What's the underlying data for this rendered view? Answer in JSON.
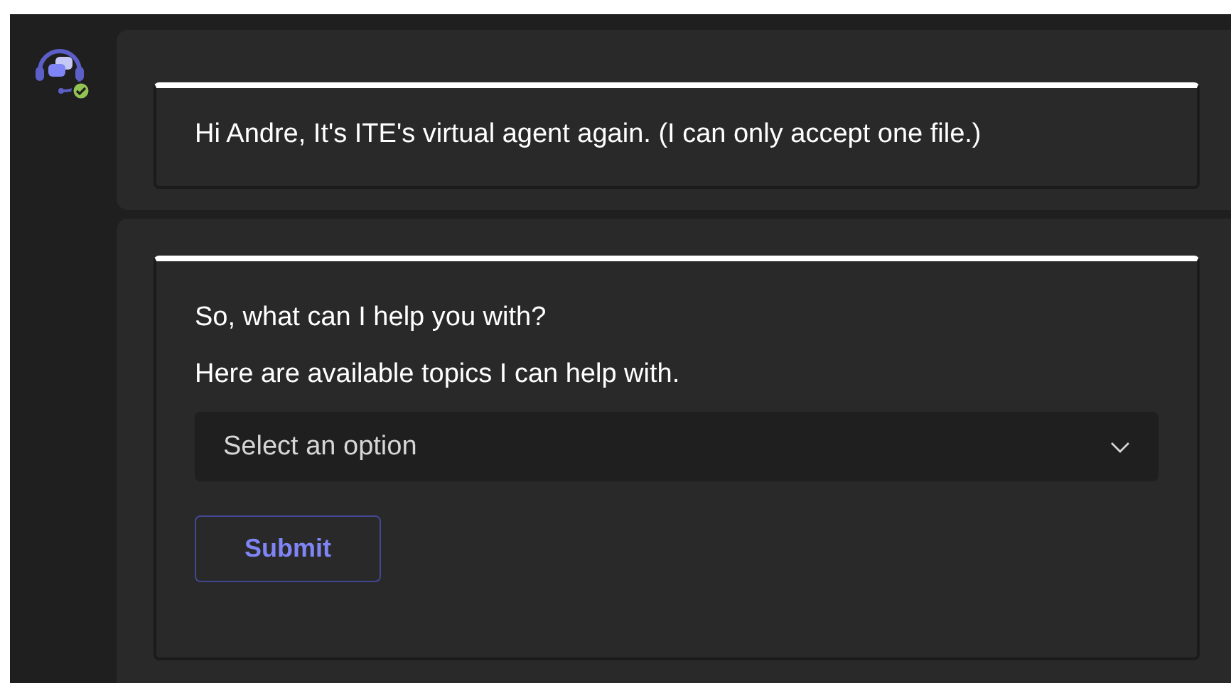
{
  "messages": [
    {
      "kind": "text",
      "text": "Hi Andre, It's ITE's virtual agent again. (I can only accept one file.)"
    },
    {
      "kind": "form",
      "prompt": "So, what can I help you with?",
      "hint": "Here are available topics I can help with.",
      "dropdown": {
        "placeholder": "Select an option"
      },
      "button": "Submit"
    }
  ]
}
